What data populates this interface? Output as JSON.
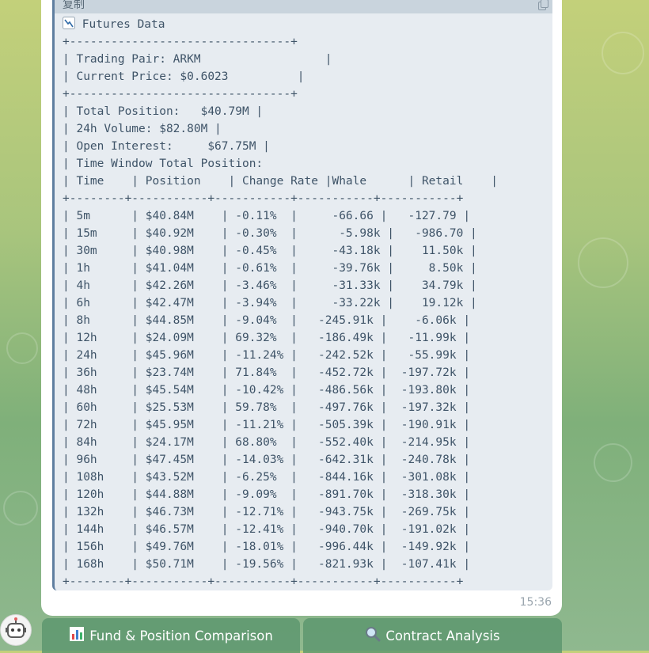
{
  "message": {
    "copy_label": "复制",
    "title": "Futures Data",
    "time": "15:36",
    "code_lines": [
      "+--------------------------------+",
      "| Trading Pair: ARKM                  |",
      "| Current Price: $0.6023          |",
      "+--------------------------------+",
      "| Total Position:   $40.79M |",
      "| 24h Volume: $82.80M |",
      "| Open Interest:     $67.75M |",
      "| Time Window Total Position:",
      "| Time    | Position    | Change Rate |Whale      | Retail    |",
      "+--------+-----------+-----------+-----------+-----------+",
      "| 5m      | $40.84M    | -0.11%  |     -66.66 |   -127.79 |",
      "| 15m     | $40.92M    | -0.30%  |      -5.98k |   -986.70 |",
      "| 30m     | $40.98M    | -0.45%  |     -43.18k |    11.50k |",
      "| 1h      | $41.04M    | -0.61%  |     -39.76k |     8.50k |",
      "| 4h      | $42.26M    | -3.46%  |     -31.33k |    34.79k |",
      "| 6h      | $42.47M    | -3.94%  |     -33.22k |    19.12k |",
      "| 8h      | $44.85M    | -9.04%  |   -245.91k |    -6.06k |",
      "| 12h     | $24.09M    | 69.32%  |   -186.49k |   -11.99k |",
      "| 24h     | $45.96M    | -11.24% |   -242.52k |   -55.99k |",
      "| 36h     | $23.74M    | 71.84%  |   -452.72k |  -197.72k |",
      "| 48h     | $45.54M    | -10.42% |   -486.56k |  -193.80k |",
      "| 60h     | $25.53M    | 59.78%  |   -497.76k |  -197.32k |",
      "| 72h     | $45.95M    | -11.21% |   -505.39k |  -190.91k |",
      "| 84h     | $24.17M    | 68.80%  |   -552.40k |  -214.95k |",
      "| 96h     | $47.45M    | -14.03% |   -642.31k |  -240.78k |",
      "| 108h    | $43.52M    | -6.25%  |   -844.16k |  -301.08k |",
      "| 120h    | $44.88M    | -9.09%  |   -891.70k |  -318.30k |",
      "| 132h    | $46.73M    | -12.71% |   -943.75k |  -269.75k |",
      "| 144h    | $46.57M    | -12.41% |   -940.70k |  -191.02k |",
      "| 156h    | $49.76M    | -18.01% |   -996.44k |  -149.92k |",
      "| 168h    | $50.71M    | -19.56% |   -821.93k |  -107.41k |",
      "+--------+-----------+-----------+-----------+-----------+"
    ]
  },
  "keyboard": {
    "buttons": [
      {
        "icon": "bar-chart-icon",
        "label": "Fund & Position Comparison"
      },
      {
        "icon": "magnifier-icon",
        "label": "Contract Analysis"
      }
    ]
  }
}
